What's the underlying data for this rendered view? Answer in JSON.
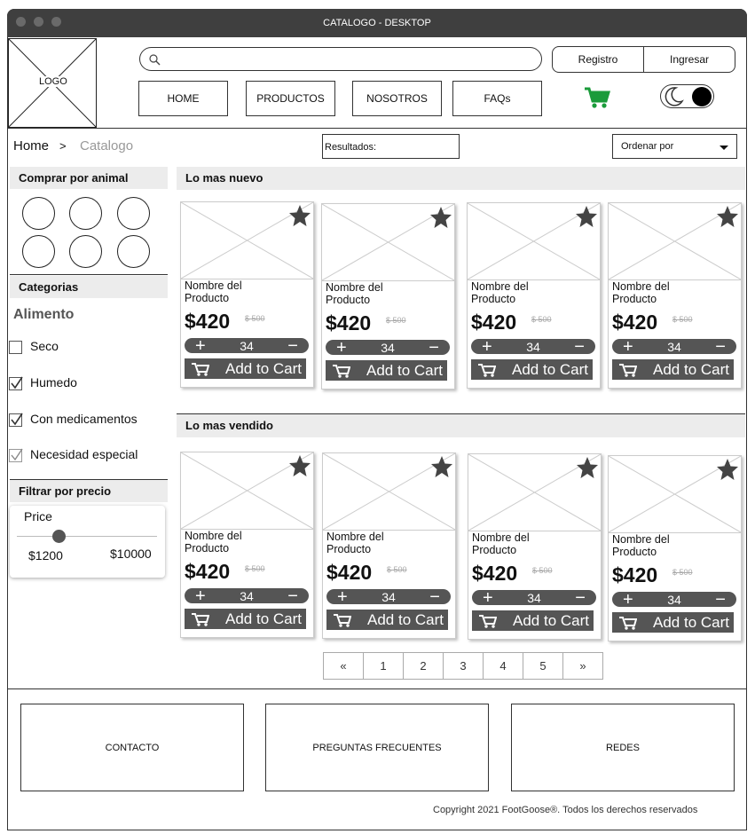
{
  "window": {
    "title": "CATALOGO - DESKTOP"
  },
  "header": {
    "logo": "LOGO",
    "search": {
      "placeholder": "",
      "value": ""
    },
    "auth": {
      "register": "Registro",
      "login": "Ingresar"
    },
    "nav": [
      "HOME",
      "PRODUCTOS",
      "NOSOTROS",
      "FAQs"
    ],
    "cart_color": "#1a9b3a"
  },
  "breadcrumb": {
    "home": "Home",
    "sep": ">",
    "current": "Catalogo"
  },
  "results": {
    "label": "Resultados:"
  },
  "sort": {
    "label": "Ordenar por"
  },
  "sidebar": {
    "animal_title": "Comprar por animal",
    "categories_title": "Categorias",
    "group_title": "Alimento",
    "filters": [
      {
        "label": "Seco",
        "checked": false
      },
      {
        "label": "Humedo",
        "checked": true
      },
      {
        "label": "Con medicamentos",
        "checked": true
      },
      {
        "label": "Necesidad especial",
        "checked": true
      }
    ],
    "price_title": "Filtrar por precio",
    "price": {
      "label": "Price",
      "min": "$1200",
      "max": "$10000",
      "level": 0.3
    }
  },
  "sections": {
    "newest": "Lo mas nuevo",
    "bestsellers": "Lo mas vendido"
  },
  "product": {
    "name_line1": "Nombre del",
    "name_line2": "Producto",
    "price": "$420",
    "old_price": "$ 500",
    "qty": "34",
    "add_label": "Add to Cart"
  },
  "pagination": [
    "«",
    "1",
    "2",
    "3",
    "4",
    "5",
    "»"
  ],
  "footer": {
    "contact": "CONTACTO",
    "faq": "PREGUNTAS FRECUENTES",
    "social": "REDES",
    "copyright": "Copyright 2021 FootGoose®. Todos los derechos reservados"
  }
}
